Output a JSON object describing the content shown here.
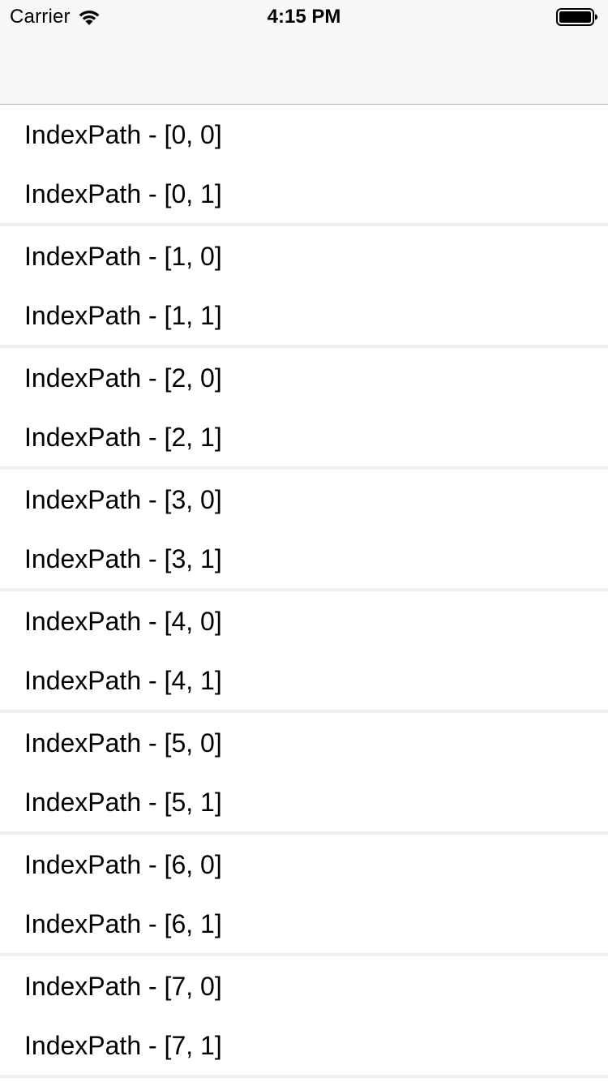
{
  "status_bar": {
    "carrier": "Carrier",
    "time": "4:15 PM",
    "wifi_icon": "wifi-icon",
    "battery_icon": "battery-icon"
  },
  "navigation_bar": {
    "title": ""
  },
  "table": {
    "sections": [
      {
        "rows": [
          "IndexPath - [0, 0]",
          "IndexPath - [0, 1]"
        ]
      },
      {
        "rows": [
          "IndexPath - [1, 0]",
          "IndexPath - [1, 1]"
        ]
      },
      {
        "rows": [
          "IndexPath - [2, 0]",
          "IndexPath - [2, 1]"
        ]
      },
      {
        "rows": [
          "IndexPath - [3, 0]",
          "IndexPath - [3, 1]"
        ]
      },
      {
        "rows": [
          "IndexPath - [4, 0]",
          "IndexPath - [4, 1]"
        ]
      },
      {
        "rows": [
          "IndexPath - [5, 0]",
          "IndexPath - [5, 1]"
        ]
      },
      {
        "rows": [
          "IndexPath - [6, 0]",
          "IndexPath - [6, 1]"
        ]
      },
      {
        "rows": [
          "IndexPath - [7, 0]",
          "IndexPath - [7, 1]"
        ]
      }
    ]
  },
  "colors": {
    "bar_background": "#f7f7f7",
    "separator": "#efeff4",
    "text": "#000000"
  }
}
